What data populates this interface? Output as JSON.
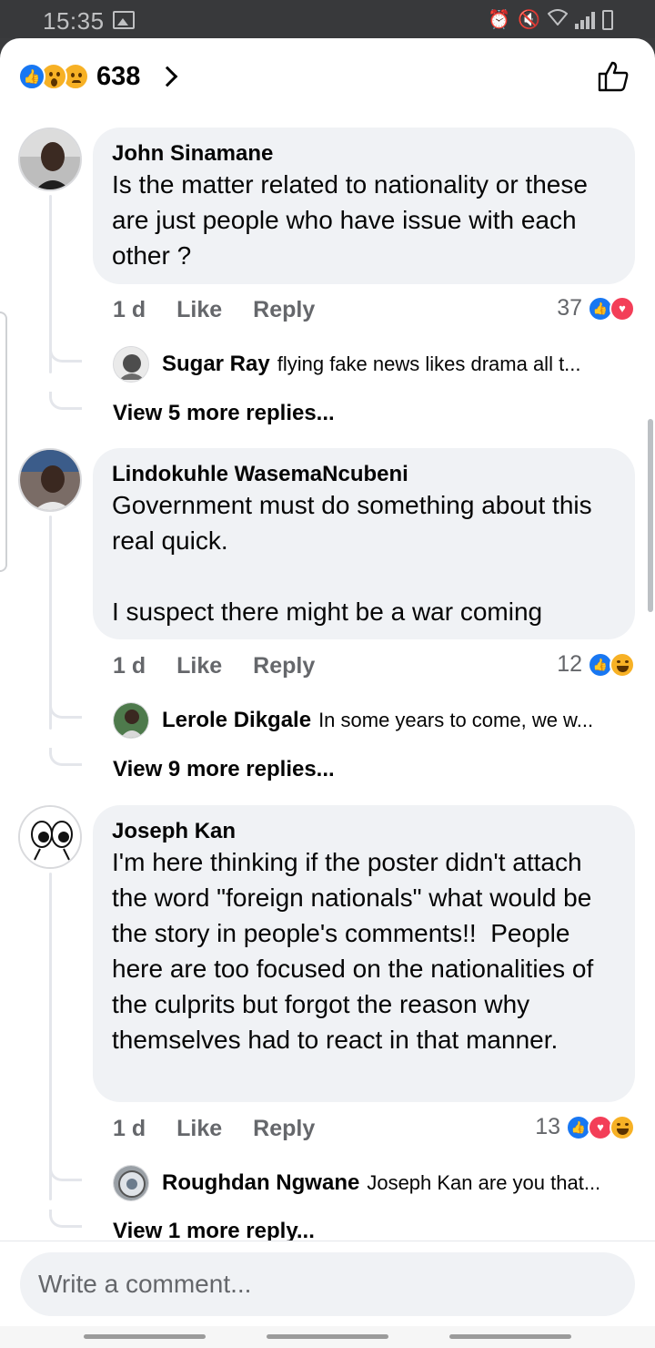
{
  "status_bar": {
    "time": "15:35"
  },
  "reactions": {
    "count": "638"
  },
  "comments": [
    {
      "author": "John Sinamane",
      "text": "Is the matter related to nationality or these are just people who have issue with each other ?",
      "time": "1 d",
      "like_label": "Like",
      "reply_label": "Reply",
      "reaction_count": "37",
      "reaction_types": [
        "like",
        "love"
      ],
      "reply_preview": {
        "author": "Sugar Ray",
        "text": "flying fake news likes drama all t..."
      },
      "view_more": "View 5 more replies..."
    },
    {
      "author": "Lindokuhle WasemaNcubeni",
      "text": "Government must do something about this real quick.\n\nI suspect there might be a war coming",
      "time": "1 d",
      "like_label": "Like",
      "reply_label": "Reply",
      "reaction_count": "12",
      "reaction_types": [
        "like",
        "haha"
      ],
      "reply_preview": {
        "author": "Lerole Dikgale",
        "text": "In some years to come, we w..."
      },
      "view_more": "View 9 more replies..."
    },
    {
      "author": "Joseph Kan",
      "text": "I'm here thinking if the poster didn't attach the word \"foreign nationals\" what would be the story in people's comments!!  People here are too focused on the nationalities of the culprits but forgot the reason why themselves had to react in that manner.",
      "time": "1 d",
      "like_label": "Like",
      "reply_label": "Reply",
      "reaction_count": "13",
      "reaction_types": [
        "like",
        "love",
        "haha"
      ],
      "reply_preview": {
        "author": "Roughdan Ngwane",
        "text": "Joseph Kan are you that..."
      },
      "view_more": "View 1 more reply..."
    }
  ],
  "composer": {
    "placeholder": "Write a comment..."
  },
  "colors": {
    "accent": "#1877f2",
    "love": "#f33e58",
    "emoji": "#f7b125",
    "bubble": "#f0f2f5",
    "meta": "#65676b"
  }
}
